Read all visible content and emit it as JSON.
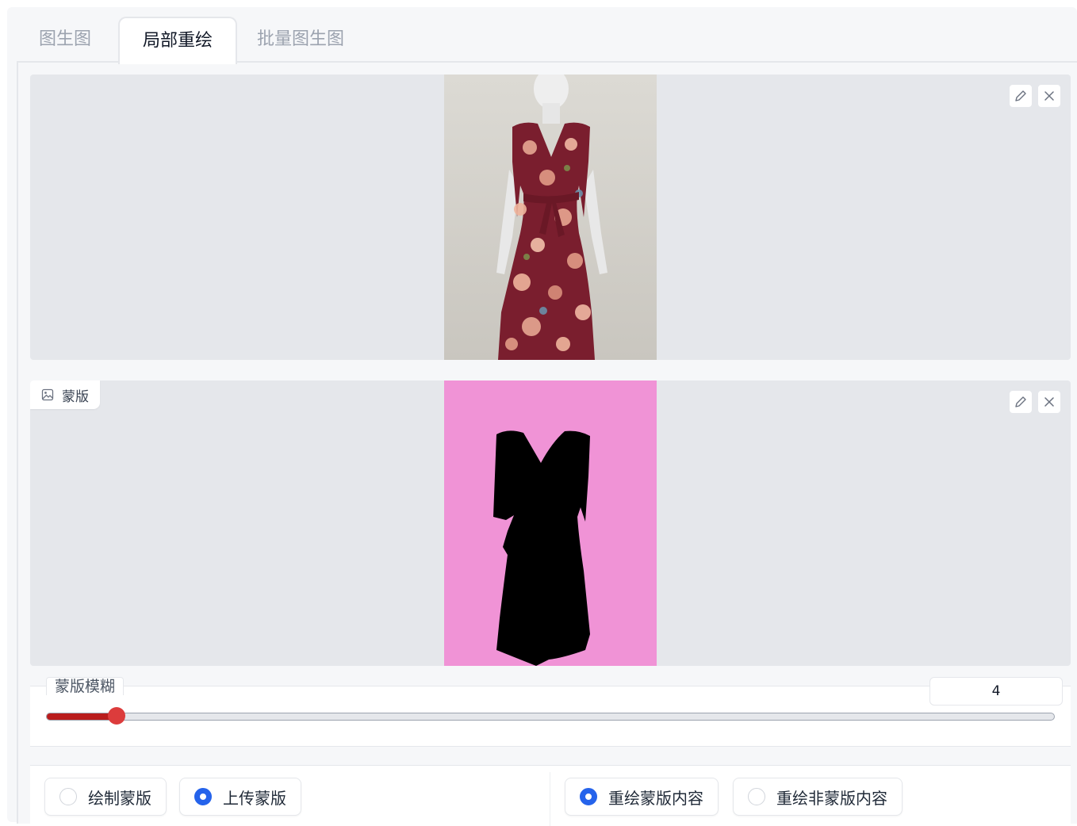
{
  "tabs": [
    {
      "label": "图生图",
      "active": false
    },
    {
      "label": "局部重绘",
      "active": true
    },
    {
      "label": "批量图生图",
      "active": false
    }
  ],
  "source_image": {
    "icons": [
      "edit-icon",
      "close-icon"
    ]
  },
  "mask_image": {
    "label": "蒙版",
    "icons": [
      "image-icon",
      "edit-icon",
      "close-icon"
    ]
  },
  "mask_blur": {
    "label": "蒙版模糊",
    "value": "4",
    "slider_fraction": 0.07,
    "fill_color": "#b91c1c",
    "thumb_color": "#dc3c3c"
  },
  "mask_mode": {
    "options": [
      {
        "label": "绘制蒙版",
        "selected": false
      },
      {
        "label": "上传蒙版",
        "selected": true
      }
    ]
  },
  "inpaint_target": {
    "options": [
      {
        "label": "重绘蒙版内容",
        "selected": true
      },
      {
        "label": "重绘非蒙版内容",
        "selected": false
      }
    ]
  },
  "colors": {
    "accent": "#2563eb",
    "mask_background": "#f093d6",
    "dress": "#7a1e2e"
  }
}
